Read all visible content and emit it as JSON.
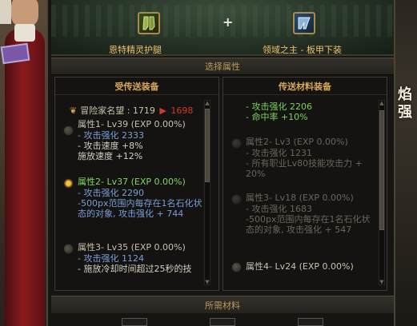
{
  "background": {
    "right_chars": [
      "焰",
      "强"
    ]
  },
  "top": {
    "left_item_name": "恩特精灵护腿",
    "right_item_name": "领域之主 - 板甲下装",
    "plus_symbol": "+"
  },
  "sections": {
    "select_attr": "选择属性",
    "required_material": "所需材料"
  },
  "left_panel": {
    "header": "受传送装备",
    "fame": {
      "label": "冒险家名望 : 1719",
      "arrow": "▶",
      "new_value": "1698"
    },
    "entries": [
      {
        "title": "属性1- Lv39 (EXP 0.00%)",
        "lines": [
          "- 攻击强化 2333",
          "- 攻击速度 +8%",
          "施放速度 +12%"
        ],
        "state": "normal"
      },
      {
        "title": "属性2- Lv37 (EXP 0.00%)",
        "lines": [
          "- 攻击强化 2290",
          "-500px范围内每存在1名石化状态的对象, 攻击强化 + 744"
        ],
        "state": "selected"
      },
      {
        "title": "属性3- Lv35 (EXP 0.00%)",
        "lines": [
          "- 攻击强化 1124",
          "- 施放冷却时间超过25秒的技"
        ],
        "state": "normal"
      }
    ]
  },
  "right_panel": {
    "header": "传送材料装备",
    "top_lines": [
      "- 攻击强化 2206",
      "- 命中率 +10%"
    ],
    "entries": [
      {
        "title": "属性2- Lv3 (EXP 0.00%)",
        "lines": [
          "- 攻击强化 1231",
          "- 所有职业Lv80技能攻击力 + 20%"
        ],
        "state": "dim"
      },
      {
        "title": "属性3- Lv18 (EXP 0.00%)",
        "lines": [
          "- 攻击强化 1683",
          "-500px范围内每存在1名石化状态的对象, 攻击强化 + 547"
        ],
        "state": "dim"
      },
      {
        "title": "属性4- Lv24 (EXP 0.00%)",
        "lines": [],
        "state": "normal"
      }
    ]
  },
  "colors": {
    "gold": "#d8a85a",
    "selected_green": "#7fd861",
    "attack_blue": "#7a9ed8",
    "fame_red": "#cc3b2a"
  }
}
